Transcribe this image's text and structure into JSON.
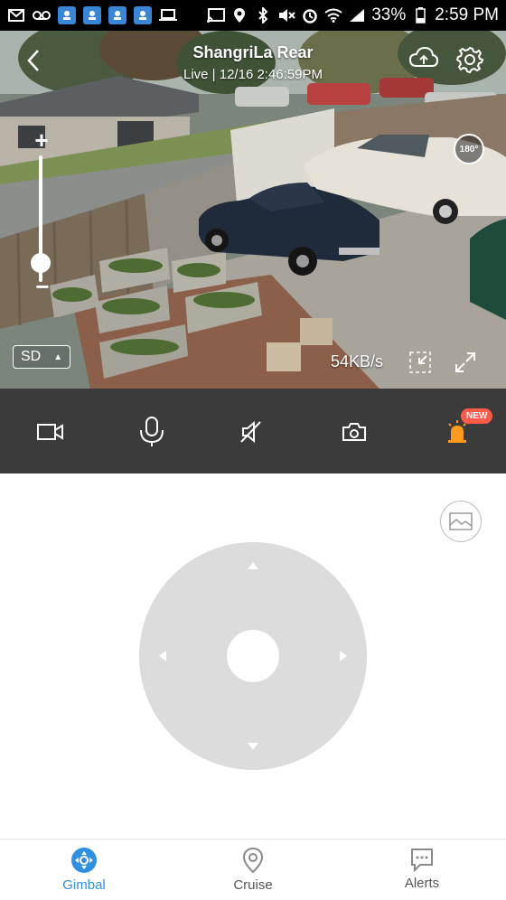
{
  "statusbar": {
    "battery": "33%",
    "time": "2:59 PM",
    "left_icons": [
      "mail-icon",
      "voicemail-icon",
      "app-icon",
      "app-icon",
      "app-icon",
      "app-icon",
      "laptop-icon"
    ],
    "right_icons": [
      "cast-icon",
      "location-icon",
      "bluetooth-icon",
      "mute-icon",
      "alarm-icon",
      "wifi-icon",
      "signal-icon",
      "battery-icon"
    ]
  },
  "camera": {
    "name": "ShangriLa Rear",
    "status_line": "Live | 12/16 2:46:59PM",
    "rotate_label": "180°",
    "quality": "SD",
    "speed": "54KB/s",
    "zoom_level": 0.2
  },
  "controls": {
    "items": [
      "record-icon",
      "microphone-icon",
      "speaker-muted-icon",
      "snapshot-icon",
      "siren-icon"
    ],
    "badge": "NEW"
  },
  "colors": {
    "accent": "#2f8fe0",
    "control_bar": "#3b3b3b",
    "badge": "#ff5a4a",
    "siren": "#ff9a1f",
    "joystick": "#dcdcdc"
  },
  "nav": {
    "items": [
      {
        "label": "Gimbal",
        "icon": "gimbal-icon",
        "active": true
      },
      {
        "label": "Cruise",
        "icon": "location-pin-icon",
        "active": false
      },
      {
        "label": "Alerts",
        "icon": "chat-icon",
        "active": false
      }
    ]
  }
}
